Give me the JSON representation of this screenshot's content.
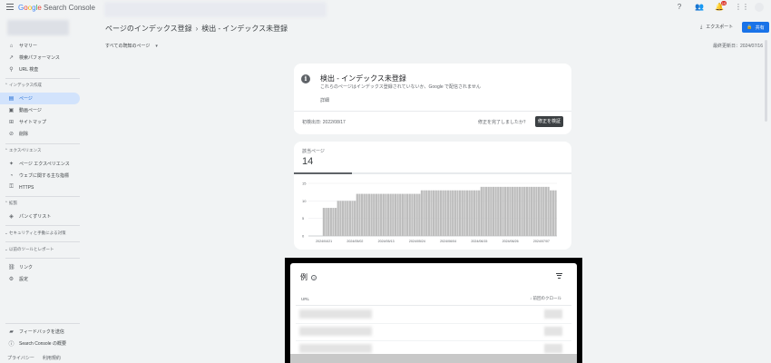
{
  "header": {
    "logo_text": "Google Search Console",
    "logo_parts": [
      "G",
      "o",
      "o",
      "g",
      "l",
      "e"
    ],
    "logo_suffix": " Search Console",
    "notification_count": "10"
  },
  "page": {
    "breadcrumb_parent": "ページのインデックス登録",
    "breadcrumb_current": "検出 - インデックス未登録",
    "export_label": "エクスポート",
    "share_label": "共有",
    "filter_label": "すべての既知のページ",
    "last_updated": "最終更新日：2024/07/16"
  },
  "sidebar": {
    "items": [
      {
        "icon": "home-icon",
        "glyph": "⌂",
        "label": "サマリー"
      },
      {
        "icon": "trending-icon",
        "glyph": "↗",
        "label": "検索パフォーマンス"
      },
      {
        "icon": "search-icon",
        "glyph": "⚲",
        "label": "URL 検査"
      }
    ],
    "section_index": "インデックス作成",
    "index_items": [
      {
        "icon": "page-icon",
        "glyph": "▤",
        "label": "ページ"
      },
      {
        "icon": "video-icon",
        "glyph": "▣",
        "label": "動画ページ"
      },
      {
        "icon": "sitemap-icon",
        "glyph": "⊞",
        "label": "サイトマップ"
      },
      {
        "icon": "removal-icon",
        "glyph": "⊘",
        "label": "削除"
      }
    ],
    "section_experience": "エクスペリエンス",
    "experience_items": [
      {
        "icon": "experience-icon",
        "glyph": "✦",
        "label": "ページ エクスペリエンス"
      },
      {
        "icon": "speed-icon",
        "glyph": "◔",
        "label": "ウェブに関する主な指標"
      },
      {
        "icon": "lock-icon",
        "glyph": "🔒",
        "label": "HTTPS"
      }
    ],
    "section_enhancements": "拡張",
    "enhancement_items": [
      {
        "icon": "breadcrumb-icon",
        "glyph": "◈",
        "label": "パンくずリスト"
      }
    ],
    "section_security": "セキュリティと手動による対策",
    "section_legacy": "以前のツールとレポート",
    "bottom_items": [
      {
        "icon": "links-icon",
        "glyph": "⛓",
        "label": "リンク"
      },
      {
        "icon": "settings-icon",
        "glyph": "⚙",
        "label": "設定"
      }
    ],
    "footer_items": [
      {
        "icon": "feedback-icon",
        "glyph": "▰",
        "label": "フィードバックを送信"
      },
      {
        "icon": "info-icon",
        "glyph": "ⓘ",
        "label": "Search Console の概要"
      }
    ],
    "footer_links": [
      "プライバシー",
      "利用規約"
    ]
  },
  "status_card": {
    "title": "検出 - インデックス未登録",
    "subtitle": "これらのページはインデックス登録されていないか、Google で配信されません",
    "details": "詳細",
    "first_detected": "初検出日: 2022/08/17",
    "fixed_question": "修正を完了しましたか？",
    "validate_label": "修正を検証"
  },
  "affected_card": {
    "label": "該当ページ",
    "count": "14"
  },
  "examples_card": {
    "title": "例",
    "col_url": "URL",
    "col_crawl": "前回のクロール"
  },
  "colors": {
    "accent": "#1a73e8",
    "nav_active_bg": "#d2e3fc",
    "bar_fill": "#bdbdbd"
  },
  "chart_data": {
    "type": "bar",
    "title": "",
    "xlabel": "",
    "ylabel": "",
    "ylim": [
      0,
      15
    ],
    "yticks": [
      0,
      5,
      10,
      15
    ],
    "x_tick_labels": [
      "2024/04/21",
      "2024/05/02",
      "2024/05/13",
      "2024/05/24",
      "2024/06/04",
      "2024/06/15",
      "2024/06/26",
      "2024/07/07"
    ],
    "segments": [
      {
        "bars": 6,
        "value": 0
      },
      {
        "bars": 6,
        "value": 8
      },
      {
        "bars": 8,
        "value": 10
      },
      {
        "bars": 27,
        "value": 12
      },
      {
        "bars": 25,
        "value": 13
      },
      {
        "bars": 29,
        "value": 14
      },
      {
        "bars": 3,
        "value": 13
      }
    ]
  }
}
